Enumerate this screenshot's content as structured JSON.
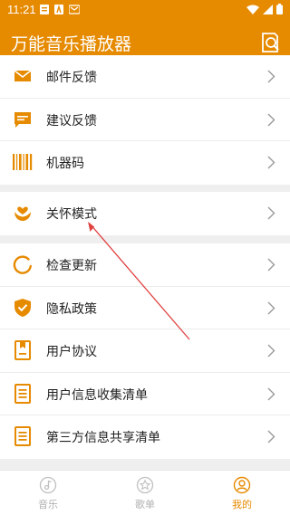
{
  "status": {
    "time": "11:21"
  },
  "app": {
    "title": "万能音乐播放器"
  },
  "group1": [
    {
      "label": "邮件反馈",
      "icon": "mail-icon"
    },
    {
      "label": "建议反馈",
      "icon": "message-icon"
    },
    {
      "label": "机器码",
      "icon": "barcode-icon"
    }
  ],
  "group2": [
    {
      "label": "关怀模式",
      "icon": "care-heart-icon"
    }
  ],
  "group3": [
    {
      "label": "检查更新",
      "icon": "refresh-icon"
    },
    {
      "label": "隐私政策",
      "icon": "shield-check-icon"
    },
    {
      "label": "用户协议",
      "icon": "document-icon"
    },
    {
      "label": "用户信息收集清单",
      "icon": "list-doc-icon"
    },
    {
      "label": "第三方信息共享清单",
      "icon": "list-doc-icon"
    }
  ],
  "bottom_nav": [
    {
      "label": "音乐",
      "icon": "music-note-icon",
      "active": false
    },
    {
      "label": "歌单",
      "icon": "star-icon",
      "active": false
    },
    {
      "label": "我的",
      "icon": "user-icon",
      "active": true
    }
  ],
  "colors": {
    "accent": "#e68a00",
    "annotation": "#e04040"
  }
}
